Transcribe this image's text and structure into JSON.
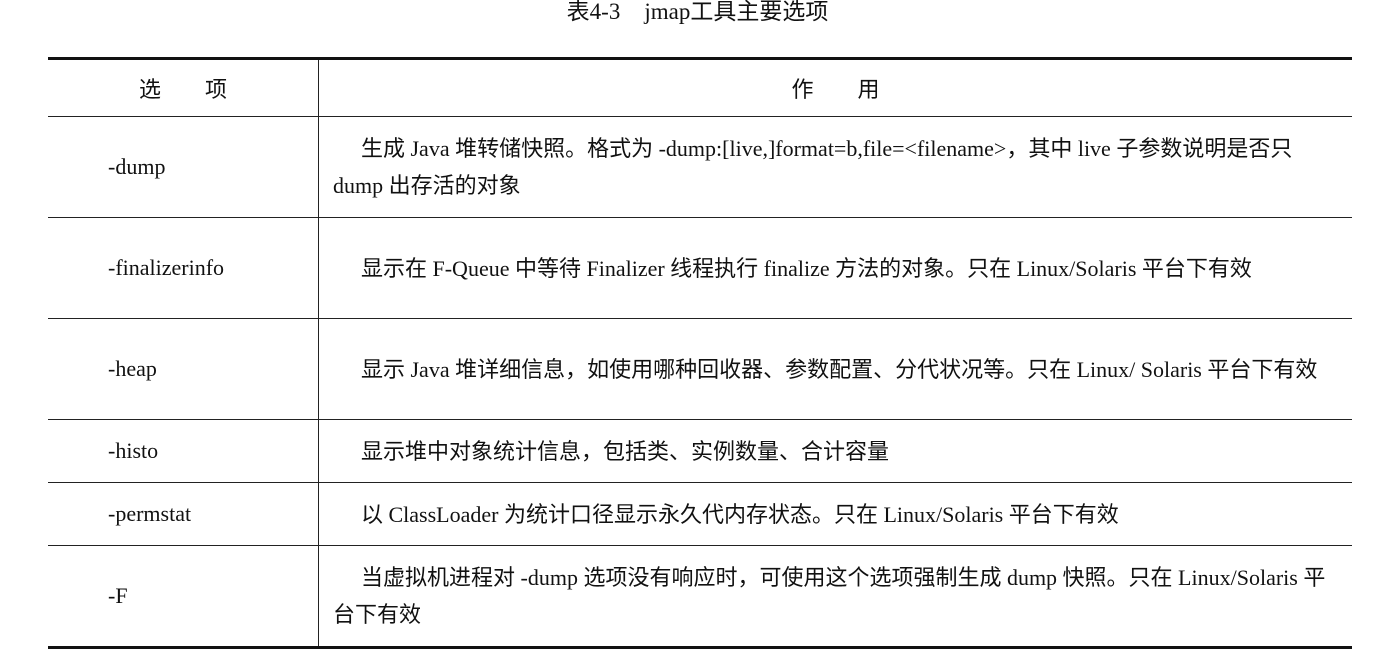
{
  "caption": {
    "number": "表4-3",
    "text": "jmap工具主要选项"
  },
  "table": {
    "headers": [
      "选　　项",
      "作　　用"
    ],
    "rows": [
      {
        "option": "-dump",
        "description": "生成 Java 堆转储快照。格式为 -dump:[live,]format=b,file=<filename>，其中 live 子参数说明是否只 dump 出存活的对象"
      },
      {
        "option": "-finalizerinfo",
        "description": "显示在 F-Queue 中等待 Finalizer 线程执行 finalize 方法的对象。只在 Linux/Solaris 平台下有效"
      },
      {
        "option": "-heap",
        "description": "显示 Java 堆详细信息，如使用哪种回收器、参数配置、分代状况等。只在 Linux/ Solaris 平台下有效"
      },
      {
        "option": "-histo",
        "description": "显示堆中对象统计信息，包括类、实例数量、合计容量"
      },
      {
        "option": "-permstat",
        "description": "以 ClassLoader 为统计口径显示永久代内存状态。只在 Linux/Solaris 平台下有效"
      },
      {
        "option": "-F",
        "description": "当虚拟机进程对 -dump 选项没有响应时，可使用这个选项强制生成 dump 快照。只在 Linux/Solaris 平台下有效"
      }
    ]
  }
}
